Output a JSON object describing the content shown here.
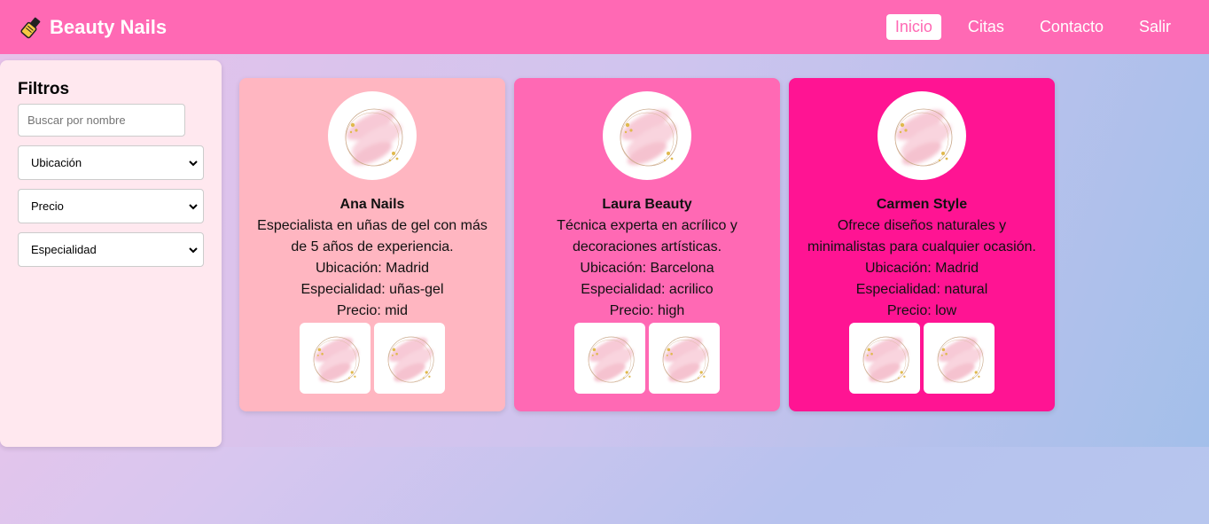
{
  "header": {
    "brand": "Beauty Nails",
    "brand_icon": "nail-polish-icon",
    "nav": [
      {
        "label": "Inicio",
        "active": true
      },
      {
        "label": "Citas",
        "active": false
      },
      {
        "label": "Contacto",
        "active": false
      },
      {
        "label": "Salir",
        "active": false
      }
    ]
  },
  "sidebar": {
    "title": "Filtros",
    "search_placeholder": "Buscar por nombre",
    "selects": [
      "Ubicación",
      "Precio",
      "Especialidad"
    ]
  },
  "cards": [
    {
      "name": "Ana Nails",
      "description": "Especialista en uñas de gel con más de 5 años de experiencia.",
      "location": "Ubicación: Madrid",
      "specialty": "Especialidad: uñas-gel",
      "price": "Precio: mid",
      "color": "#ffb6c1"
    },
    {
      "name": "Laura Beauty",
      "description": "Técnica experta en acrílico y decoraciones artísticas.",
      "location": "Ubicación: Barcelona",
      "specialty": "Especialidad: acrilico",
      "price": "Precio: high",
      "color": "#ff69b4"
    },
    {
      "name": "Carmen Style",
      "description": "Ofrece diseños naturales y minimalistas para cualquier ocasión.",
      "location": "Ubicación: Madrid",
      "specialty": "Especialidad: natural",
      "price": "Precio: low",
      "color": "#ff1493"
    }
  ],
  "colors": {
    "header": "#ff69b4",
    "sidebar": "#ffe8ef"
  }
}
